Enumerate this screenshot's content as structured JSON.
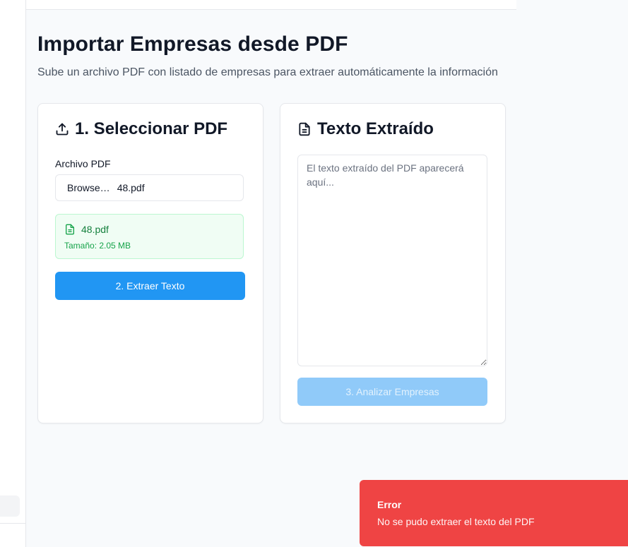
{
  "header": {
    "title": "Importar Empresas desde PDF",
    "subtitle": "Sube un archivo PDF con listado de empresas para extraer automáticamente la información"
  },
  "select_card": {
    "heading": "1. Seleccionar PDF",
    "icon": "upload-icon",
    "file_label": "Archivo PDF",
    "browse_label": "Browse…",
    "selected_file": "48.pdf",
    "file_info": {
      "icon": "file-text-icon",
      "name": "48.pdf",
      "size": "Tamaño: 2.05 MB"
    },
    "extract_button": "2. Extraer Texto"
  },
  "text_card": {
    "heading": "Texto Extraído",
    "icon": "file-text-icon",
    "textarea_value": "",
    "textarea_placeholder": "El texto extraído del PDF aparecerá aquí...",
    "analyze_button": "3. Analizar Empresas"
  },
  "toast": {
    "title": "Error",
    "message": "No se pudo extraer el texto del PDF"
  },
  "colors": {
    "primary": "#2196f3",
    "primary_disabled": "#90caf9",
    "success_bg": "#f0fdf4",
    "success_text": "#15803d",
    "error": "#ef4444"
  }
}
